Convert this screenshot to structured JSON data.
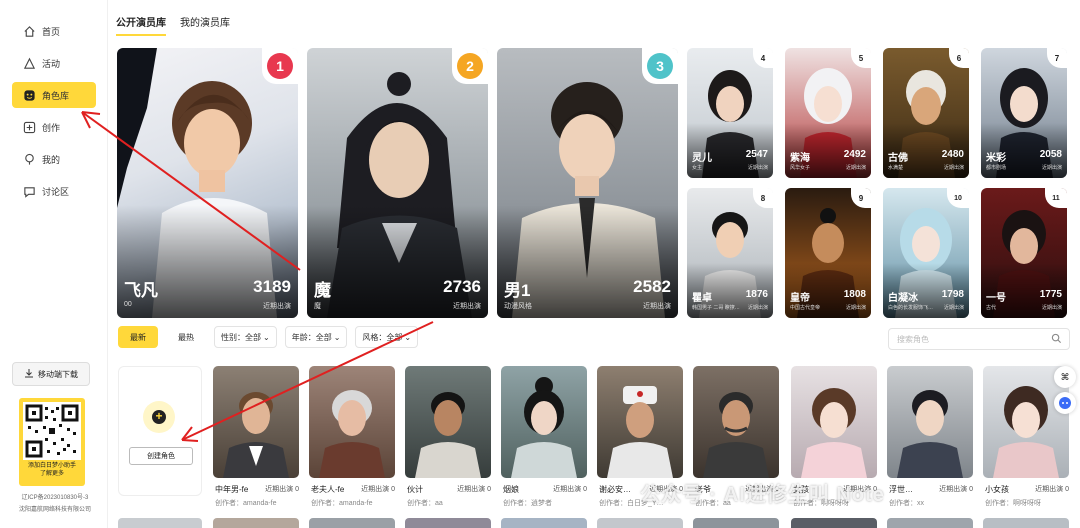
{
  "sidebar": {
    "items": [
      {
        "label": "首页",
        "icon": "home-icon"
      },
      {
        "label": "活动",
        "icon": "activity-icon"
      },
      {
        "label": "角色库",
        "icon": "character-icon"
      },
      {
        "label": "创作",
        "icon": "create-icon"
      },
      {
        "label": "我的",
        "icon": "profile-icon"
      },
      {
        "label": "讨论区",
        "icon": "chat-icon"
      }
    ],
    "download_label": "移动端下载",
    "qr_caption_1": "添加白日梦小助手",
    "qr_caption_2": "了解更多",
    "icp_1": "辽ICP备2023010830号-3",
    "icp_2": "沈阳嘉航网络科技有限公司"
  },
  "tabs": [
    "公开演员库",
    "我的演员库"
  ],
  "featured": [
    {
      "name": "飞凡",
      "sub": "00",
      "count": "3189",
      "cap": "近期出演",
      "rank": "1"
    },
    {
      "name": "魔",
      "sub": "魔",
      "count": "2736",
      "cap": "近期出演",
      "rank": "2"
    },
    {
      "name": "男1",
      "sub": "动漫风格",
      "count": "2582",
      "cap": "近期出演",
      "rank": "3"
    }
  ],
  "top_grid": [
    {
      "name": "灵儿",
      "sub": "女主",
      "count": "2547",
      "cap": "近期出演",
      "rank": "4"
    },
    {
      "name": "紫海",
      "sub": "风华女子",
      "count": "2492",
      "cap": "近期出演",
      "rank": "5"
    },
    {
      "name": "古佛",
      "sub": "水满楚",
      "count": "2480",
      "cap": "近期出演",
      "rank": "6"
    },
    {
      "name": "米彩",
      "sub": "都市剧场",
      "count": "2058",
      "cap": "近期出演",
      "rank": "7"
    },
    {
      "name": "瞿卓",
      "sub": "韩国男子 二哥 瞭撩…",
      "count": "1876",
      "cap": "近期出演",
      "rank": "8"
    },
    {
      "name": "皇帝",
      "sub": "中国古代皇帝",
      "count": "1808",
      "cap": "近期出演",
      "rank": "9"
    },
    {
      "name": "白凝冰",
      "sub": "白色的长发服饰飞…",
      "count": "1798",
      "cap": "近期出演",
      "rank": "10"
    },
    {
      "name": "一号",
      "sub": "古代",
      "count": "1775",
      "cap": "近期出演",
      "rank": "11"
    }
  ],
  "filters": {
    "latest": "最新",
    "hottest": "最热",
    "gender": "性别：全部",
    "age": "年龄：全部",
    "style": "风格：全部",
    "search_placeholder": "搜索角色"
  },
  "create_label": "创建角色",
  "actors": [
    {
      "name": "中年男-fe",
      "recent": "近期出演 0",
      "creator": "创作者：amanda-fe"
    },
    {
      "name": "老夫人-fe",
      "recent": "近期出演 0",
      "creator": "创作者：amanda-fe"
    },
    {
      "name": "伙计",
      "recent": "近期出演 0",
      "creator": "创作者：aa"
    },
    {
      "name": "烟娘",
      "recent": "近期出演 0",
      "creator": "创作者：逍梦者"
    },
    {
      "name": "谢必安…",
      "recent": "近期出演 0",
      "creator": "创作者：白日梦_Y…"
    },
    {
      "name": "老爷",
      "recent": "近期出演 0",
      "creator": "创作者：aa"
    },
    {
      "name": "女孩",
      "recent": "近期出演 0",
      "creator": "创作者：啊呀呀呀"
    },
    {
      "name": "浮世…",
      "recent": "近期出演 0",
      "creator": "创作者：xx"
    },
    {
      "name": "小女孩",
      "recent": "近期出演 0",
      "creator": "创作者：啊呀呀呀"
    }
  ],
  "watermark": "公众号 · AI进修生叫 Note",
  "colors": {
    "accent": "#ffd83a",
    "rank1": "#e8384f",
    "rank2": "#f5a623",
    "rank3": "#4fc3c9",
    "arrow": "#e02020"
  }
}
